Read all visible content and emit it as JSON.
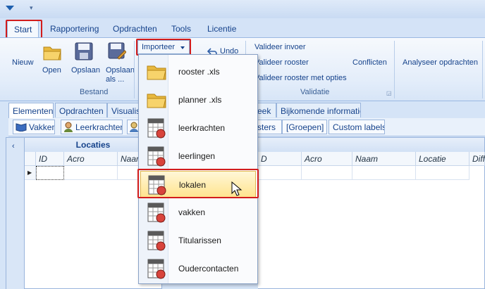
{
  "ribbon_tabs": [
    "Start",
    "Rapportering",
    "Opdrachten",
    "Tools",
    "Licentie"
  ],
  "bestand": {
    "new_label": "Nieuw",
    "open_label": "Open",
    "save_label": "Opslaan",
    "save_as_label": "Opslaan als ...",
    "caption": "Bestand"
  },
  "importeer_label": "Importeer",
  "undo_label": "Undo",
  "validatie": {
    "items": [
      "Valideer invoer",
      "Valideer rooster",
      "Valideer rooster met opties"
    ],
    "conflicts_label": "Conflicten",
    "caption": "Validatie"
  },
  "analyse_label": "Analyseer opdrachten",
  "panel_tabs": [
    "Elementen",
    "Opdrachten",
    "Visualisa",
    "eek",
    "Bijkomende informatie"
  ],
  "toolbar_buttons": [
    "Vakken",
    "Leerkrachten",
    "sters",
    "[Groepen]",
    "Custom labels"
  ],
  "left_grid": {
    "title": "Locaties",
    "columns": [
      "ID",
      "Acro",
      "Naam"
    ]
  },
  "right_grid": {
    "columns": [
      "D",
      "Acro",
      "Naam",
      "Locatie",
      "Diff"
    ]
  },
  "import_menu": {
    "items": [
      {
        "label": "rooster .xls",
        "icon": "folder-icon"
      },
      {
        "label": "planner .xls",
        "icon": "folder-icon"
      },
      {
        "label": "leerkrachten",
        "icon": "spreadsheet-icon"
      },
      {
        "label": "leerlingen",
        "icon": "spreadsheet-icon"
      },
      {
        "label": "lokalen",
        "icon": "spreadsheet-icon"
      },
      {
        "label": "vakken",
        "icon": "spreadsheet-icon"
      },
      {
        "label": "Titularissen",
        "icon": "spreadsheet-icon"
      },
      {
        "label": "Oudercontacten",
        "icon": "spreadsheet-icon"
      }
    ],
    "highlighted": "lokalen"
  },
  "colors": {
    "accent": "#15428b",
    "highlight_box": "#d21c1c"
  }
}
